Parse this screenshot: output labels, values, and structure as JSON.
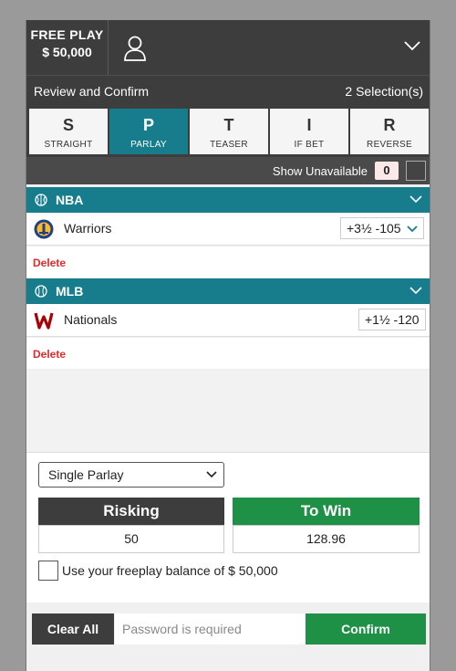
{
  "header": {
    "free_play_label": "FREE PLAY",
    "balance": "$ 50,000",
    "user_icon": "user-icon",
    "menu_icon": "chevron-down-icon"
  },
  "review": {
    "title": "Review and Confirm",
    "selections": "2 Selection(s)"
  },
  "bet_types": [
    {
      "letter": "S",
      "label": "STRAIGHT",
      "active": false
    },
    {
      "letter": "P",
      "label": "PARLAY",
      "active": true
    },
    {
      "letter": "T",
      "label": "TEASER",
      "active": false
    },
    {
      "letter": "I",
      "label": "IF BET",
      "active": false
    },
    {
      "letter": "R",
      "label": "REVERSE",
      "active": false
    }
  ],
  "unavailable": {
    "label": "Show Unavailable",
    "count": "0"
  },
  "selections": [
    {
      "sport": "NBA",
      "sport_icon": "basketball-icon",
      "team": "Warriors",
      "team_logo": "warriors-logo",
      "odds": "+3½ -105",
      "has_dropdown": true,
      "delete_label": "Delete"
    },
    {
      "sport": "MLB",
      "sport_icon": "baseball-icon",
      "team": "Nationals",
      "team_logo": "nationals-logo",
      "odds": "+1½ -120",
      "has_dropdown": false,
      "delete_label": "Delete"
    }
  ],
  "wager": {
    "type_selected": "Single Parlay",
    "risking_label": "Risking",
    "risking_value": "50",
    "towin_label": "To Win",
    "towin_value": "128.96",
    "freeplay_label": "Use your freeplay balance of $ 50,000"
  },
  "footer": {
    "clear_label": "Clear All",
    "password_placeholder": "Password is required",
    "confirm_label": "Confirm"
  },
  "colors": {
    "teal": "#177d8c",
    "dark": "#3d3d3d",
    "green": "#1e9146",
    "delete_red": "#e52a2a"
  }
}
